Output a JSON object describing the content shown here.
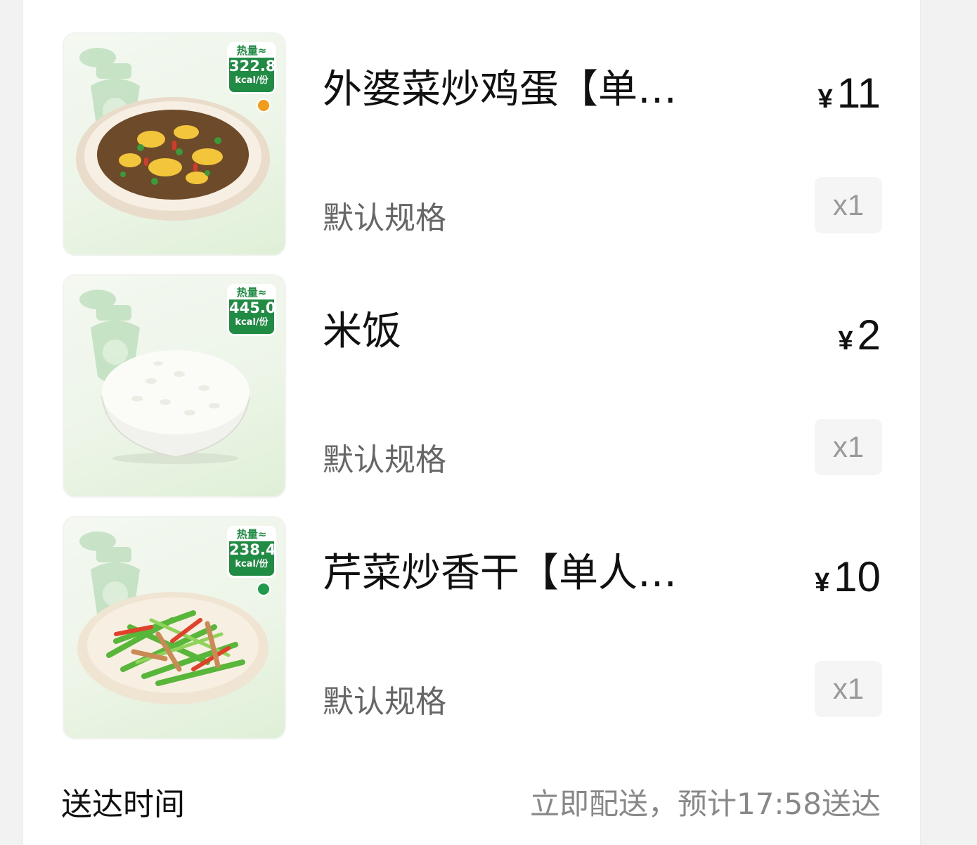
{
  "order_items": [
    {
      "name": "外婆菜炒鸡蛋【单…",
      "price_symbol": "¥",
      "price": "11",
      "spec": "默认规格",
      "quantity": "x1",
      "calorie_label": "热量≈",
      "calorie_value": "322.8",
      "calorie_unit": "kcal/份",
      "diet_dot_color": "#f39b1b",
      "photo": "stir-fried-egg-dish-image"
    },
    {
      "name": "米饭",
      "price_symbol": "¥",
      "price": "2",
      "spec": "默认规格",
      "quantity": "x1",
      "calorie_label": "热量≈",
      "calorie_value": "445.0",
      "calorie_unit": "kcal/份",
      "photo": "rice-bowl-image"
    },
    {
      "name": "芹菜炒香干【单人…",
      "price_symbol": "¥",
      "price": "10",
      "spec": "默认规格",
      "quantity": "x1",
      "calorie_label": "热量≈",
      "calorie_value": "238.4",
      "calorie_unit": "kcal/份",
      "diet_dot_color": "#1f9b4a",
      "photo": "celery-tofu-dish-image"
    }
  ],
  "delivery": {
    "label": "送达时间",
    "value": "立即配送，预计17:58送达"
  },
  "colors": {
    "badge_green": "#1f8b43",
    "text_primary": "#111111",
    "text_secondary": "#666666",
    "text_muted": "#888888"
  }
}
